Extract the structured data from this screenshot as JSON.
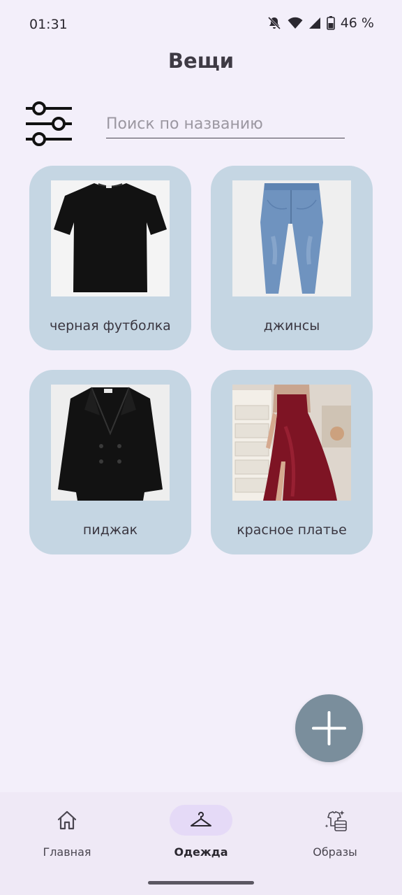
{
  "status_bar": {
    "time": "01:31",
    "battery": "46 %",
    "icons": [
      "mute-icon",
      "wifi-icon",
      "signal-icon",
      "battery-icon"
    ]
  },
  "header": {
    "title": "Вещи"
  },
  "search": {
    "placeholder": "Поиск по названию",
    "value": ""
  },
  "items": [
    {
      "label": "черная футболка",
      "image": "black-tshirt-image"
    },
    {
      "label": "джинсы",
      "image": "blue-jeans-image"
    },
    {
      "label": "пиджак",
      "image": "black-blazer-image"
    },
    {
      "label": "красное платье",
      "image": "red-dress-image"
    }
  ],
  "fab": {
    "icon": "plus-icon"
  },
  "bottom_nav": {
    "items": [
      {
        "label": "Главная",
        "icon": "home-icon",
        "active": false
      },
      {
        "label": "Одежда",
        "icon": "hanger-icon",
        "active": true
      },
      {
        "label": "Образы",
        "icon": "outfits-icon",
        "active": false
      }
    ]
  },
  "colors": {
    "background": "#f3effa",
    "card": "#c5d6e3",
    "fab": "#7a8e9c",
    "nav_active_pill": "#e5daf7",
    "nav_background": "#efe9f6"
  }
}
